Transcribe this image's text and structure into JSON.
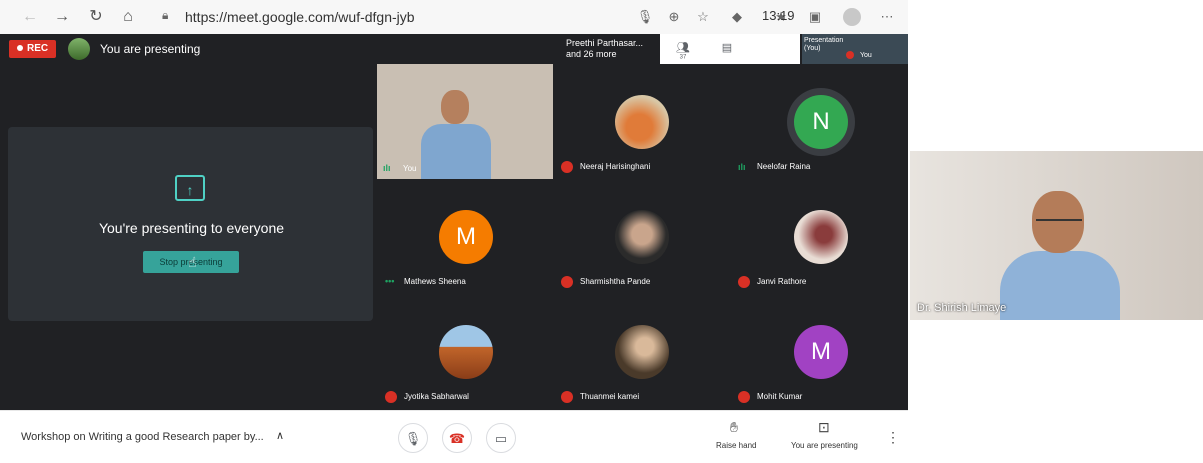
{
  "browser": {
    "url": "https://meet.google.com/wuf-dfgn-jyb"
  },
  "meet": {
    "rec_label": "REC",
    "presenting_banner": "You are presenting",
    "people_summary_line1": "Preethi Parthasar...",
    "people_summary_line2": "and 26 more",
    "participant_count": "37",
    "time": "13:19",
    "self_view_title_line1": "Presentation",
    "self_view_title_line2": "(You)",
    "self_view_you": "You",
    "present_panel": {
      "message": "You're presenting to everyone",
      "stop_button": "Stop presenting"
    },
    "tiles": [
      {
        "name": "You",
        "type": "video",
        "mic": "on"
      },
      {
        "name": "Neeraj Harisinghani",
        "type": "photo",
        "mic": "off",
        "color": "#e07b39"
      },
      {
        "name": "Neelofar Raina",
        "type": "letter",
        "letter": "N",
        "mic": "on",
        "color": "#33a852"
      },
      {
        "name": "Mathews Sheena",
        "type": "letter",
        "letter": "M",
        "mic": "on",
        "color": "#f57c00"
      },
      {
        "name": "Sharmishtha Pande",
        "type": "photo",
        "mic": "off",
        "color": "#3a3a3a"
      },
      {
        "name": "Janvi Rathore",
        "type": "photo",
        "mic": "off",
        "color": "#b88a78"
      },
      {
        "name": "Jyotika Sabharwal",
        "type": "photo",
        "mic": "off",
        "color": "#c1652a"
      },
      {
        "name": "Thuanmei kamei",
        "type": "photo",
        "mic": "off",
        "color": "#6a5a4a"
      },
      {
        "name": "Mohit Kumar",
        "type": "letter",
        "letter": "M",
        "mic": "off",
        "color": "#a142c3"
      }
    ],
    "bottom": {
      "meeting_title": "Workshop on Writing a good Research paper by...",
      "raise_hand": "Raise hand",
      "you_are_presenting": "You are presenting"
    }
  },
  "side_video": {
    "name": "Dr. Shirish Limaye"
  },
  "icons": {
    "back": "back-arrow-icon",
    "forward": "forward-arrow-icon",
    "reload": "reload-icon",
    "home": "home-icon",
    "lock": "lock-icon",
    "mic": "mic-icon",
    "end_call": "end-call-icon",
    "camera": "camera-icon",
    "hand": "raise-hand-icon",
    "present": "present-icon",
    "more": "more-vert-icon"
  }
}
